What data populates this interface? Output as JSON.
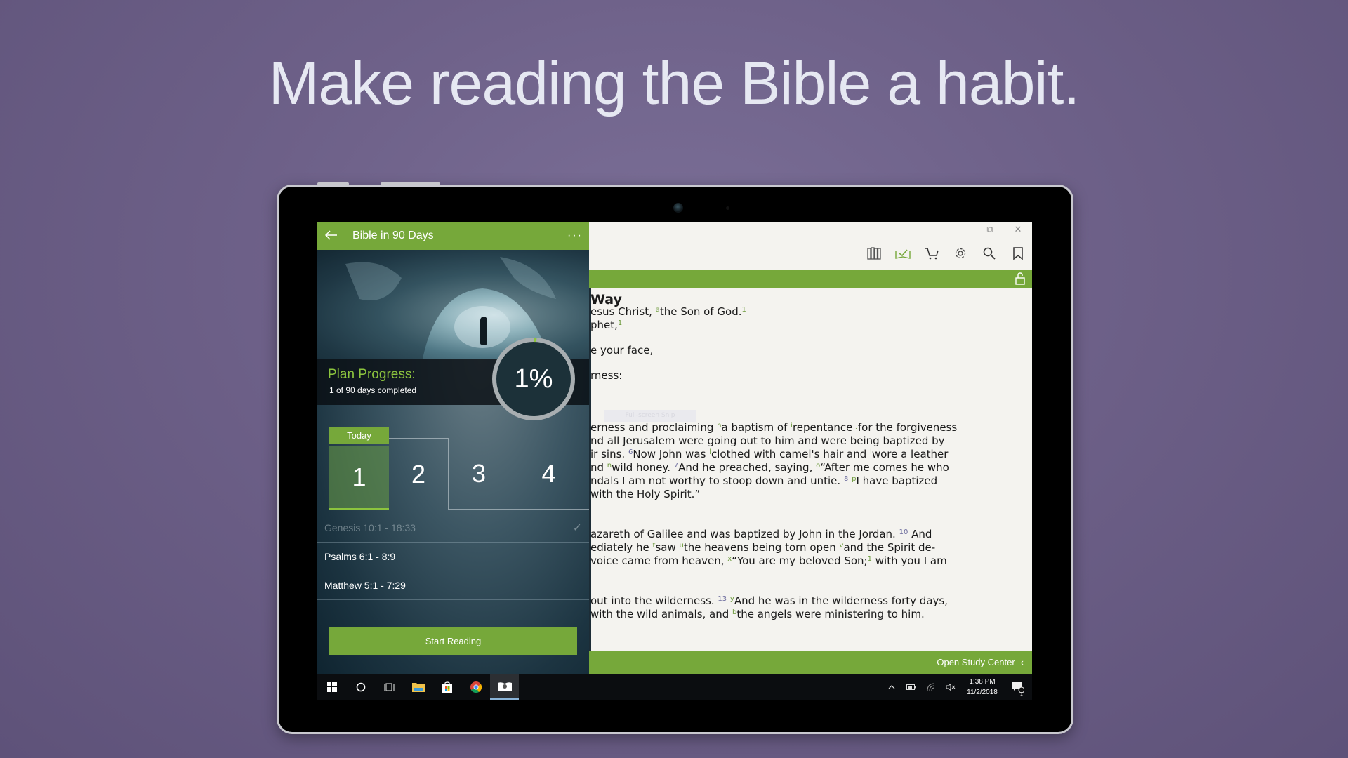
{
  "headline": "Make reading the Bible a habit.",
  "left_panel": {
    "header_title": "Bible in 90 Days",
    "back_icon": "arrow-left-icon",
    "more_icon": "more-horizontal-icon",
    "more_label": "···",
    "plan_progress_title": "Plan Progress:",
    "plan_progress_sub": "1 of 90 days completed",
    "progress_percent_label": "1%",
    "progress_fraction": 0.01,
    "today_label": "Today",
    "days": [
      "1",
      "2",
      "3",
      "4"
    ],
    "readings": [
      {
        "label": "Genesis 10:1 - 18:33",
        "completed": true
      },
      {
        "label": "Psalms 6:1 - 8:9",
        "completed": false
      },
      {
        "label": "Matthew 5:1 - 7:29",
        "completed": false
      }
    ],
    "start_button": "Start Reading"
  },
  "right_panel": {
    "window_controls": {
      "minimize": "–",
      "restore": "⧉",
      "close": "✕"
    },
    "toolbar_icons": [
      "library-icon",
      "reading-plan-icon",
      "cart-icon",
      "settings-icon",
      "search-icon",
      "bookmark-icon"
    ],
    "heading": "Way",
    "lines": {
      "l1a": "esus Christ, ",
      "l1s": "a",
      "l1b": "the Son of God.",
      "l1f": "1",
      "l2a": "phet,",
      "l2f": "1",
      "l3": "e your face,",
      "l4": "rness:",
      "l5a": "erness and proclaiming ",
      "l5s1": "h",
      "l5b": "a baptism of ",
      "l5s2": "i",
      "l5c": "repentance ",
      "l5s3": "j",
      "l5d": "for the forgiveness",
      "l6": "nd all Jerusalem were going out to him and were being baptized by",
      "l7a": "ir sins. ",
      "l7v": "6",
      "l7b": "Now John was ",
      "l7s1": "l",
      "l7c": "clothed with camel's hair and ",
      "l7s2": "l",
      "l7d": "wore a leather",
      "l8a": "nd ",
      "l8s1": "n",
      "l8b": "wild honey. ",
      "l8v": "7",
      "l8c": "And he preached, saying, ",
      "l8s2": "o",
      "l8d": "“After me comes he who",
      "l9a": "ndals I am not worthy to stoop down and untie. ",
      "l9v": "8",
      "l9s": "p",
      "l9b": "I have baptized",
      "l10": " with the Holy Spirit.”",
      "l11a": "azareth of Galilee and was baptized by John in the Jordan. ",
      "l11v": "10",
      "l11b": "And",
      "l12a": "ediately he ",
      "l12s1": "t",
      "l12b": "saw ",
      "l12s2": "u",
      "l12c": "the heavens being torn open ",
      "l12s3": "v",
      "l12d": "and the Spirit de-",
      "l13a": "voice came from heaven, ",
      "l13s": "x",
      "l13b": "“You are my beloved Son;",
      "l13f": "1",
      "l13c": " with you I am",
      "l14a": " out into the wilderness. ",
      "l14v": "13",
      "l14s": "y",
      "l14b": "And he was in the wilderness forty days,",
      "l15a": "with the wild animals, and ",
      "l15s": "b",
      "l15b": "the angels were ministering to him."
    },
    "snip_ghost": "Full-screen Snip",
    "study_center": "Open Study Center",
    "study_chevron": "‹"
  },
  "taskbar": {
    "apps": [
      "windows-start-icon",
      "cortana-icon",
      "task-view-icon",
      "file-explorer-icon",
      "store-icon",
      "chrome-icon",
      "bible-app-icon"
    ],
    "time": "1:38 PM",
    "date": "11/2/2018",
    "notification_count": "1"
  },
  "colors": {
    "accent_green": "#76a83a",
    "progress_green": "#8cc43e",
    "background_purple": "#6d6088"
  }
}
